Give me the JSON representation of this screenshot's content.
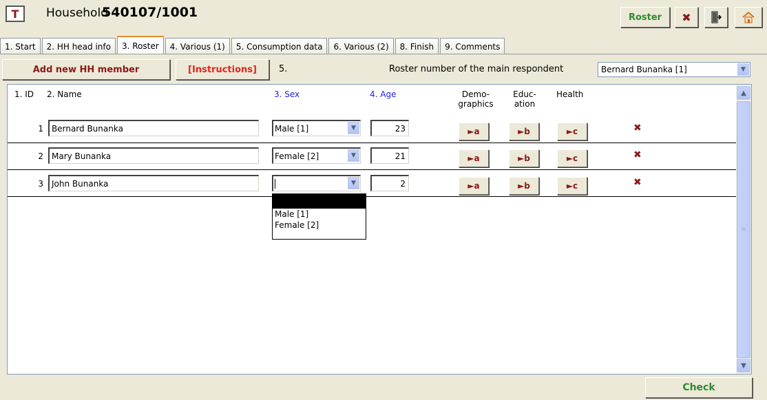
{
  "header": {
    "badge": "T",
    "household_label": "Household",
    "household_number": "540107/1001",
    "roster_button": "Roster"
  },
  "tabs": [
    {
      "label": "1. Start"
    },
    {
      "label": "2. HH head info"
    },
    {
      "label": "3. Roster",
      "active": true
    },
    {
      "label": "4. Various (1)"
    },
    {
      "label": "5. Consumption data"
    },
    {
      "label": "6. Various (2)"
    },
    {
      "label": "8. Finish"
    },
    {
      "label": "9. Comments"
    }
  ],
  "toolbar": {
    "add_member": "Add new HH member",
    "instructions": "[Instructions]",
    "question_number": "5.",
    "respondent_label": "Roster number of the main respondent",
    "respondent_value": "Bernard Bunanka [1]"
  },
  "columns": {
    "id": "1. ID",
    "name": "2. Name",
    "sex": "3. Sex",
    "age": "4. Age",
    "demographics_1": "Demo-",
    "demographics_2": "graphics",
    "education_1": "Educ-",
    "education_2": "ation",
    "health": "Health"
  },
  "rows": [
    {
      "id": "1",
      "name": "Bernard Bunanka",
      "sex": "Male  [1]",
      "age": "23",
      "a": "►a",
      "b": "►b",
      "c": "►c"
    },
    {
      "id": "2",
      "name": "Mary Bunanka",
      "sex": "Female  [2]",
      "age": "21",
      "a": "►a",
      "b": "►b",
      "c": "►c"
    },
    {
      "id": "3",
      "name": "John Bunanka",
      "sex": "",
      "age": "2",
      "a": "►a",
      "b": "►b",
      "c": "►c"
    }
  ],
  "sex_options": [
    "Male  [1]",
    "Female  [2]"
  ],
  "footer": {
    "check_button": "Check"
  },
  "colors": {
    "accent_green": "#2e8b2e",
    "accent_red": "#8b1a1a",
    "header_blue": "#1f1fe0"
  }
}
